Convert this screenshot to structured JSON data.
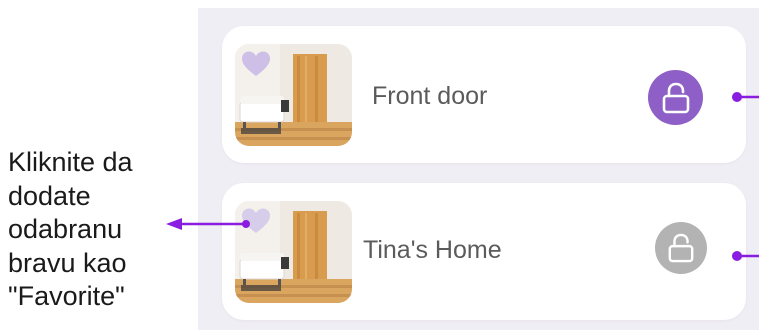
{
  "callout": {
    "lines": [
      "Kliknite da",
      "dodate",
      "odabranu",
      "bravu kao",
      "\"Favorite\""
    ]
  },
  "locks": [
    {
      "title": "Front door",
      "favorite": true,
      "lock_icon": "unlock-icon",
      "lock_color": "#8e5fc6",
      "heart_color": "#cdbfe6"
    },
    {
      "title": "Tina's Home",
      "favorite": false,
      "lock_icon": "unlock-icon",
      "lock_color": "#b3b3b3",
      "heart_color": "#d6cdea"
    }
  ],
  "colors": {
    "arrow": "#8a1ee0",
    "panel_bg": "#efeef4",
    "card_bg": "#ffffff"
  }
}
